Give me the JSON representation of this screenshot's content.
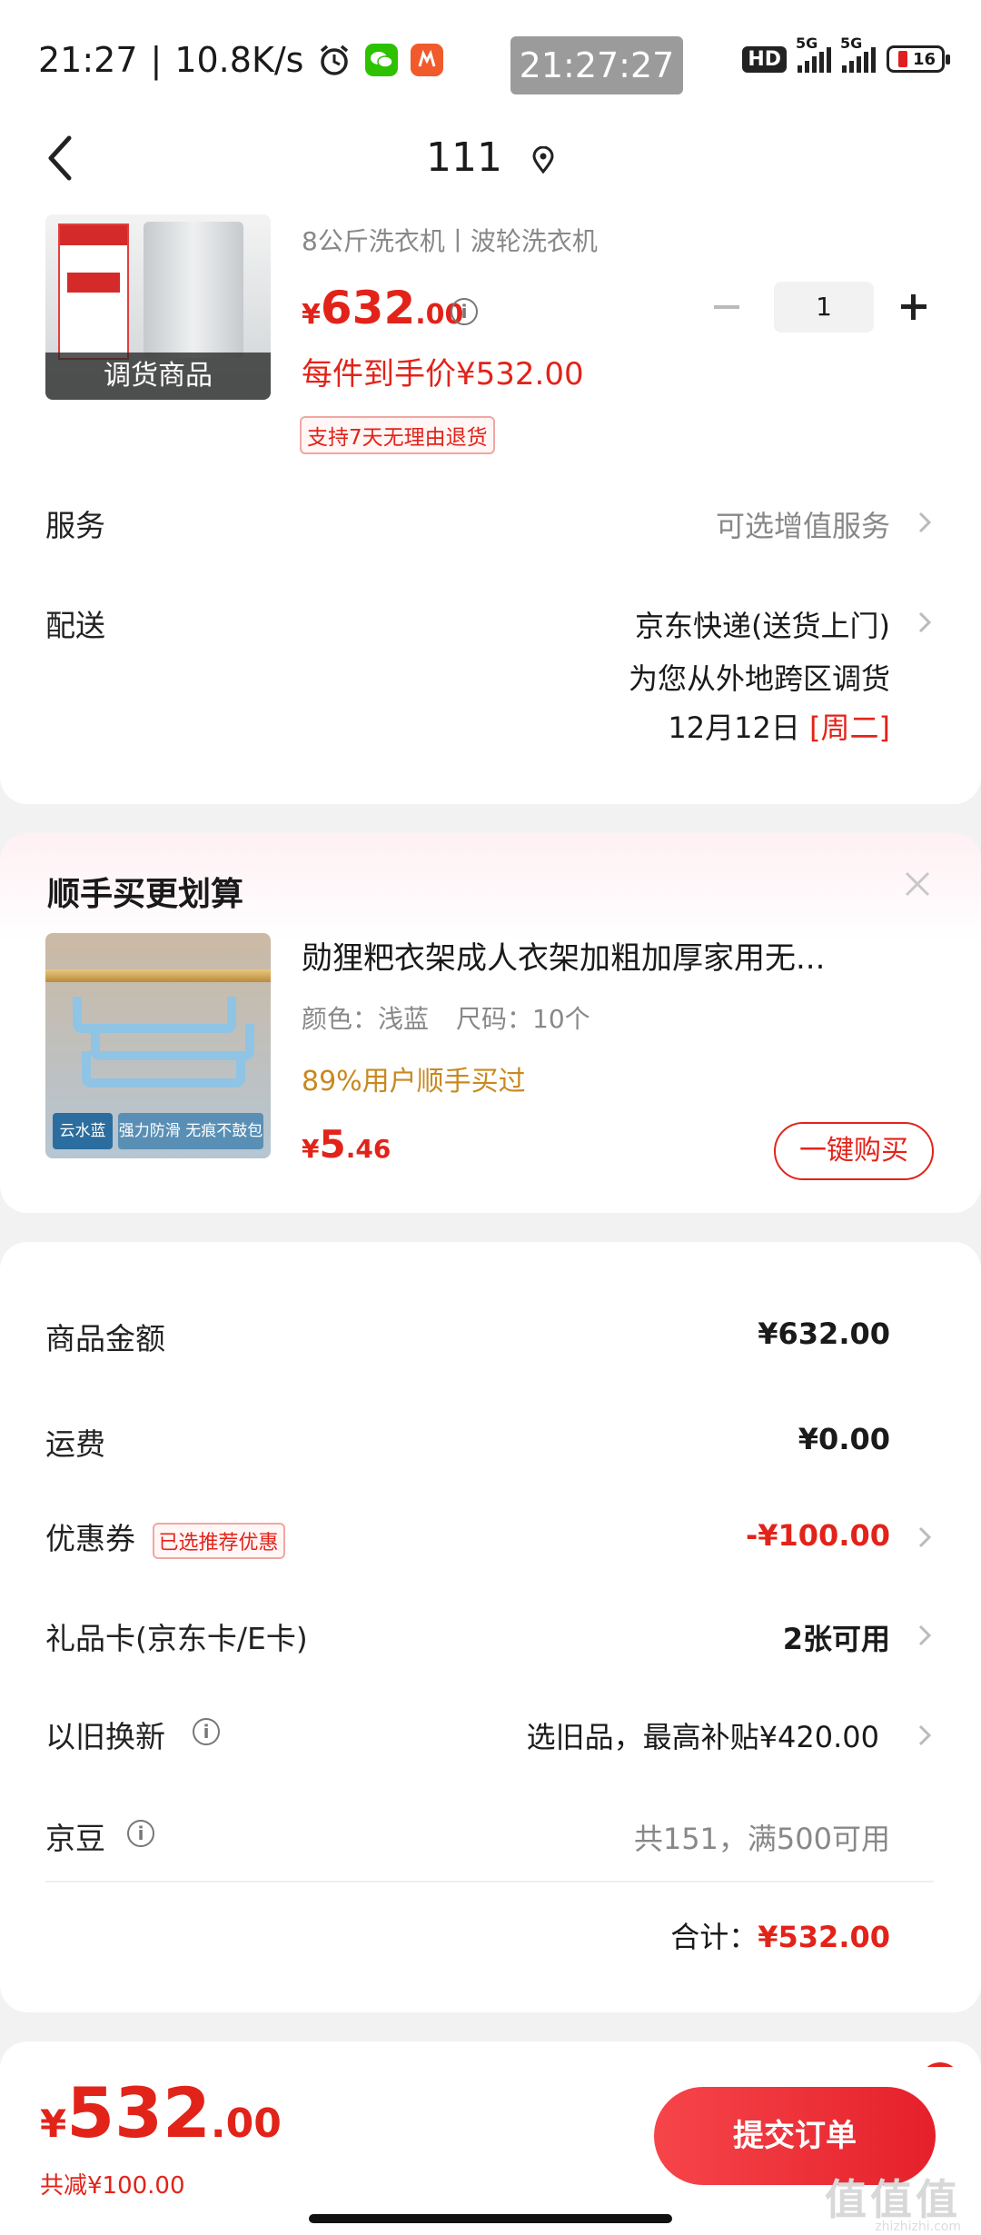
{
  "status_bar": {
    "time": "21:27",
    "speed": "10.8K/s",
    "center_clock": "21:27:27",
    "hd": "HD",
    "net1": "5G",
    "net2": "5G",
    "battery": "16",
    "icons": [
      "alarm-icon",
      "wechat-icon",
      "app-man-icon"
    ]
  },
  "header": {
    "title": "111",
    "icons": [
      "back-arrow-icon",
      "location-pin-icon"
    ]
  },
  "product": {
    "image_overlay": "调货商品",
    "spec": "8公斤洗衣机丨波轮洗衣机",
    "price_cur": "¥",
    "price_int": "632",
    "price_dec": ".00",
    "final_price": "每件到手价¥532.00",
    "return_badge": "支持7天无理由退货",
    "quantity": "1"
  },
  "service": {
    "label": "服务",
    "value": "可选增值服务"
  },
  "delivery": {
    "label": "配送",
    "method": "京东快递(送货上门)",
    "note": "为您从外地跨区调货",
    "date": "12月12日",
    "weekday": "[周二]"
  },
  "addon": {
    "title": "顺手买更划算",
    "name": "勋狸粑衣架成人衣架加粗加厚家用无...",
    "color": "颜色：浅蓝",
    "size": "尺码：10个",
    "popularity": "89%用户顺手买过",
    "price_cur": "¥",
    "price_int": "5",
    "price_dec": ".46",
    "buy_label": "一键购买",
    "img_badge": "云水蓝",
    "img_strip": "强力防滑 无痕不鼓包"
  },
  "summary": {
    "goods_label": "商品金额",
    "goods_value": "¥632.00",
    "shipping_label": "运费",
    "shipping_value": "¥0.00",
    "coupon_label": "优惠券",
    "coupon_badge": "已选推荐优惠",
    "coupon_value": "-¥100.00",
    "giftcard_label": "礼品卡(京东卡/E卡)",
    "giftcard_value": "2张可用",
    "tradein_label": "以旧换新",
    "tradein_value": "选旧品，最高补贴¥420.00",
    "jd_bean_label": "京豆",
    "jd_bean_value": "共151，满500可用",
    "total_label": "合计：",
    "total_value": "¥532.00"
  },
  "bottom": {
    "price_cur": "¥",
    "price_int": "532",
    "price_dec": ".00",
    "saved": "共减¥100.00",
    "submit": "提交订单",
    "watermark": "值值值",
    "watermark_url": "zhizhizhi.com"
  },
  "colors": {
    "accent": "#e2231a",
    "muted": "#888888",
    "background": "#f2f2f2",
    "popularity": "#c8891f"
  }
}
